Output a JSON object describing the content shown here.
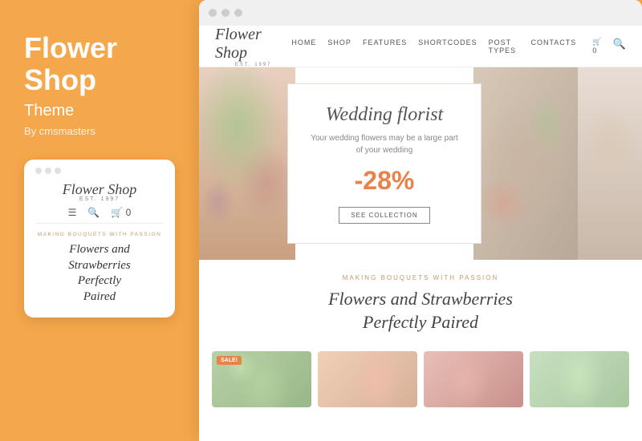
{
  "left_panel": {
    "title_line1": "Flower",
    "title_line2": "Shop",
    "subtitle": "Theme",
    "author": "By cmsmasters"
  },
  "mobile_mockup": {
    "logo": "Flower Shop",
    "logo_sub": "EST. 1997",
    "tagline": "Making Bouquets With Passion",
    "heading_line1": "Flowers and",
    "heading_line2": "Strawberries",
    "heading_line3": "Perfectly",
    "heading_line4": "Paired"
  },
  "browser": {
    "dots": [
      "dot1",
      "dot2",
      "dot3"
    ]
  },
  "site": {
    "logo": "Flower Shop",
    "logo_sub": "EST. 1997",
    "nav_links": [
      "Home",
      "Shop",
      "Features",
      "Shortcodes",
      "Post Types",
      "Contacts"
    ],
    "hero": {
      "title": "Wedding florist",
      "description_line1": "Your wedding flowers may be a large part",
      "description_line2": "of your wedding",
      "discount": "-28%",
      "cta_label": "See Collection"
    },
    "content": {
      "tagline": "Making Bouquets With Passion",
      "heading_line1": "Flowers and Strawberries",
      "heading_line2": "Perfectly Paired"
    },
    "products": [
      {
        "has_sale": true
      },
      {
        "has_sale": false
      },
      {
        "has_sale": false
      },
      {
        "has_sale": false
      }
    ],
    "sale_label": "Sale!"
  }
}
